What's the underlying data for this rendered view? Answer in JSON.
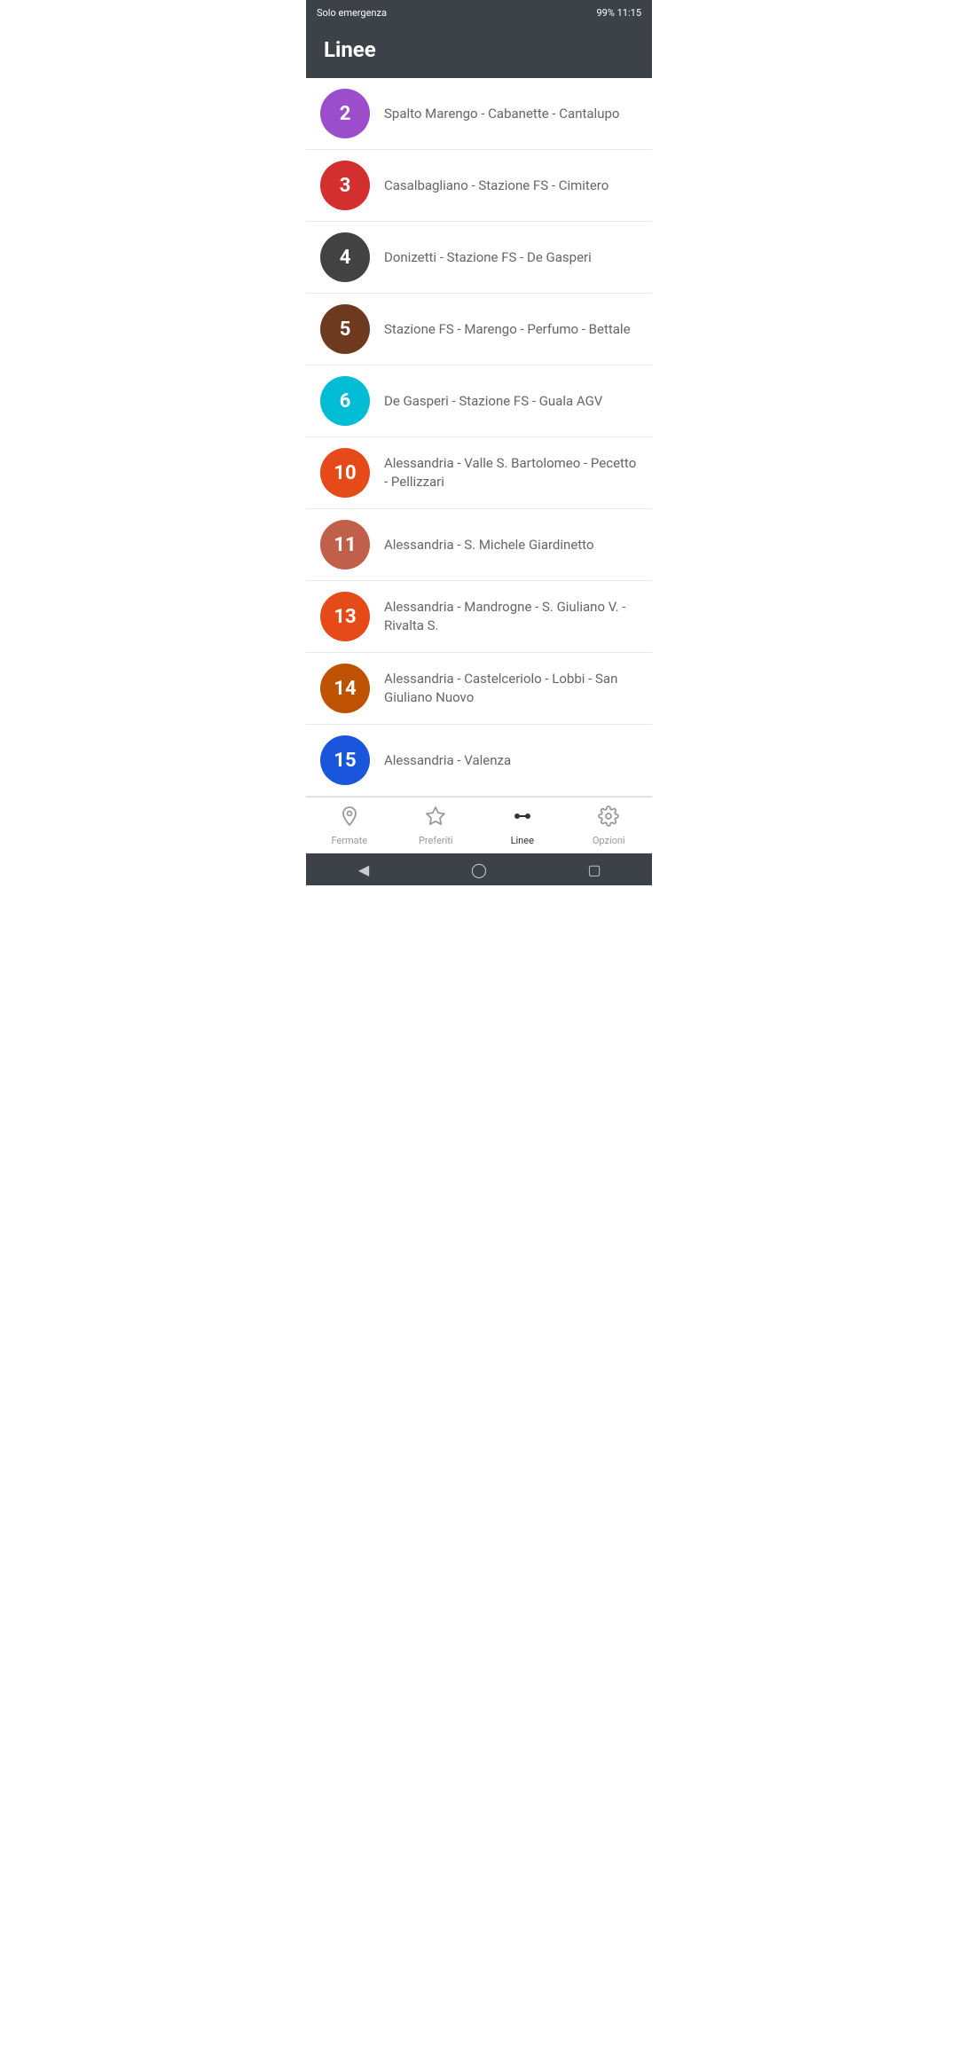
{
  "statusBar": {
    "left": "Solo emergenza",
    "right": "99%  11:15"
  },
  "header": {
    "title": "Linee"
  },
  "lines": [
    {
      "number": "2",
      "color": "#9c4dcc",
      "name": "Spalto Marengo - Cabanette - Cantalupo"
    },
    {
      "number": "3",
      "color": "#d32f2f",
      "name": "Casalbagliano - Stazione FS - Cimitero"
    },
    {
      "number": "4",
      "color": "#424242",
      "name": "Donizetti - Stazione FS - De Gasperi"
    },
    {
      "number": "5",
      "color": "#6d3a1f",
      "name": "Stazione FS - Marengo - Perfumo - Bettale"
    },
    {
      "number": "6",
      "color": "#00bcd4",
      "name": "De Gasperi - Stazione FS - Guala AGV"
    },
    {
      "number": "10",
      "color": "#e64a19",
      "name": "Alessandria - Valle S. Bartolomeo - Pecetto - Pellizzari"
    },
    {
      "number": "11",
      "color": "#c0604a",
      "name": "Alessandria - S. Michele Giardinetto"
    },
    {
      "number": "13",
      "color": "#e64a19",
      "name": "Alessandria - Mandrogne - S. Giuliano V. - Rivalta S."
    },
    {
      "number": "14",
      "color": "#bf5200",
      "name": "Alessandria - Castelceriolo - Lobbi - San Giuliano Nuovo"
    },
    {
      "number": "15",
      "color": "#1a56db",
      "name": "Alessandria - Valenza"
    }
  ],
  "bottomNav": {
    "items": [
      {
        "id": "fermate",
        "label": "Fermate",
        "active": false
      },
      {
        "id": "preferiti",
        "label": "Preferiti",
        "active": false
      },
      {
        "id": "linee",
        "label": "Linee",
        "active": true
      },
      {
        "id": "opzioni",
        "label": "Opzioni",
        "active": false
      }
    ]
  }
}
